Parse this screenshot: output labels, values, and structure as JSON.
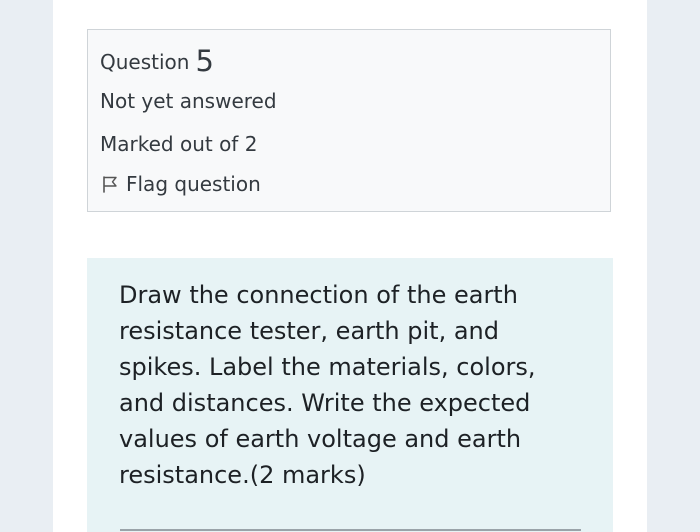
{
  "info": {
    "question_label": "Question",
    "question_number": "5",
    "state": "Not yet answered",
    "grade": "Marked out of 2",
    "flag_label": "Flag question",
    "flag_icon": "flag-icon"
  },
  "question": {
    "text": "Draw the connection of the earth resistance tester, earth pit, and spikes. Label the materials, colors, and distances. Write the expected values of earth voltage and earth resistance.",
    "marks": "(2 marks)"
  },
  "colors": {
    "background": "#e9eef3",
    "info_box": "#f8f9fa",
    "content_box": "#e7f3f5"
  }
}
